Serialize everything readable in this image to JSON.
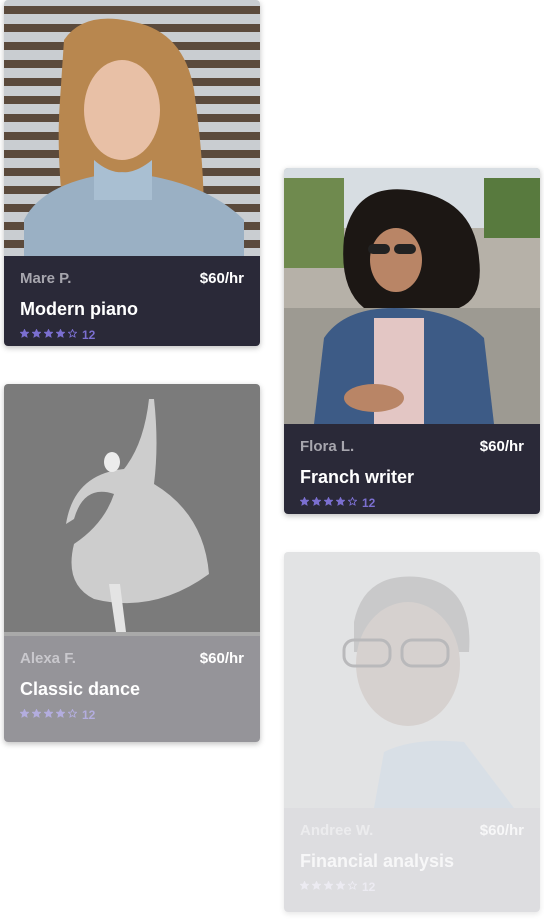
{
  "cards": [
    {
      "tutor_name": "Mare P.",
      "price": "$60/hr",
      "subject": "Modern piano",
      "rating_stars": 4,
      "rating_max": 5,
      "review_count": "12",
      "photo": "woman-with-long-hair-photo"
    },
    {
      "tutor_name": "Flora L.",
      "price": "$60/hr",
      "subject": "Franch writer",
      "rating_stars": 4,
      "rating_max": 5,
      "review_count": "12",
      "photo": "smiling-woman-in-denim-jacket-photo"
    },
    {
      "tutor_name": "Alexa F.",
      "price": "$60/hr",
      "subject": "Classic dance",
      "rating_stars": 4,
      "rating_max": 5,
      "review_count": "12",
      "photo": "dancer-photo"
    },
    {
      "tutor_name": "Andree W.",
      "price": "$60/hr",
      "subject": "Financial analysis",
      "rating_stars": 4,
      "rating_max": 5,
      "review_count": "12",
      "photo": "man-with-glasses-photo"
    }
  ],
  "colors": {
    "card_footer": "#2a2938",
    "star": "#7b6fd0",
    "price_text": "#ffffff"
  }
}
